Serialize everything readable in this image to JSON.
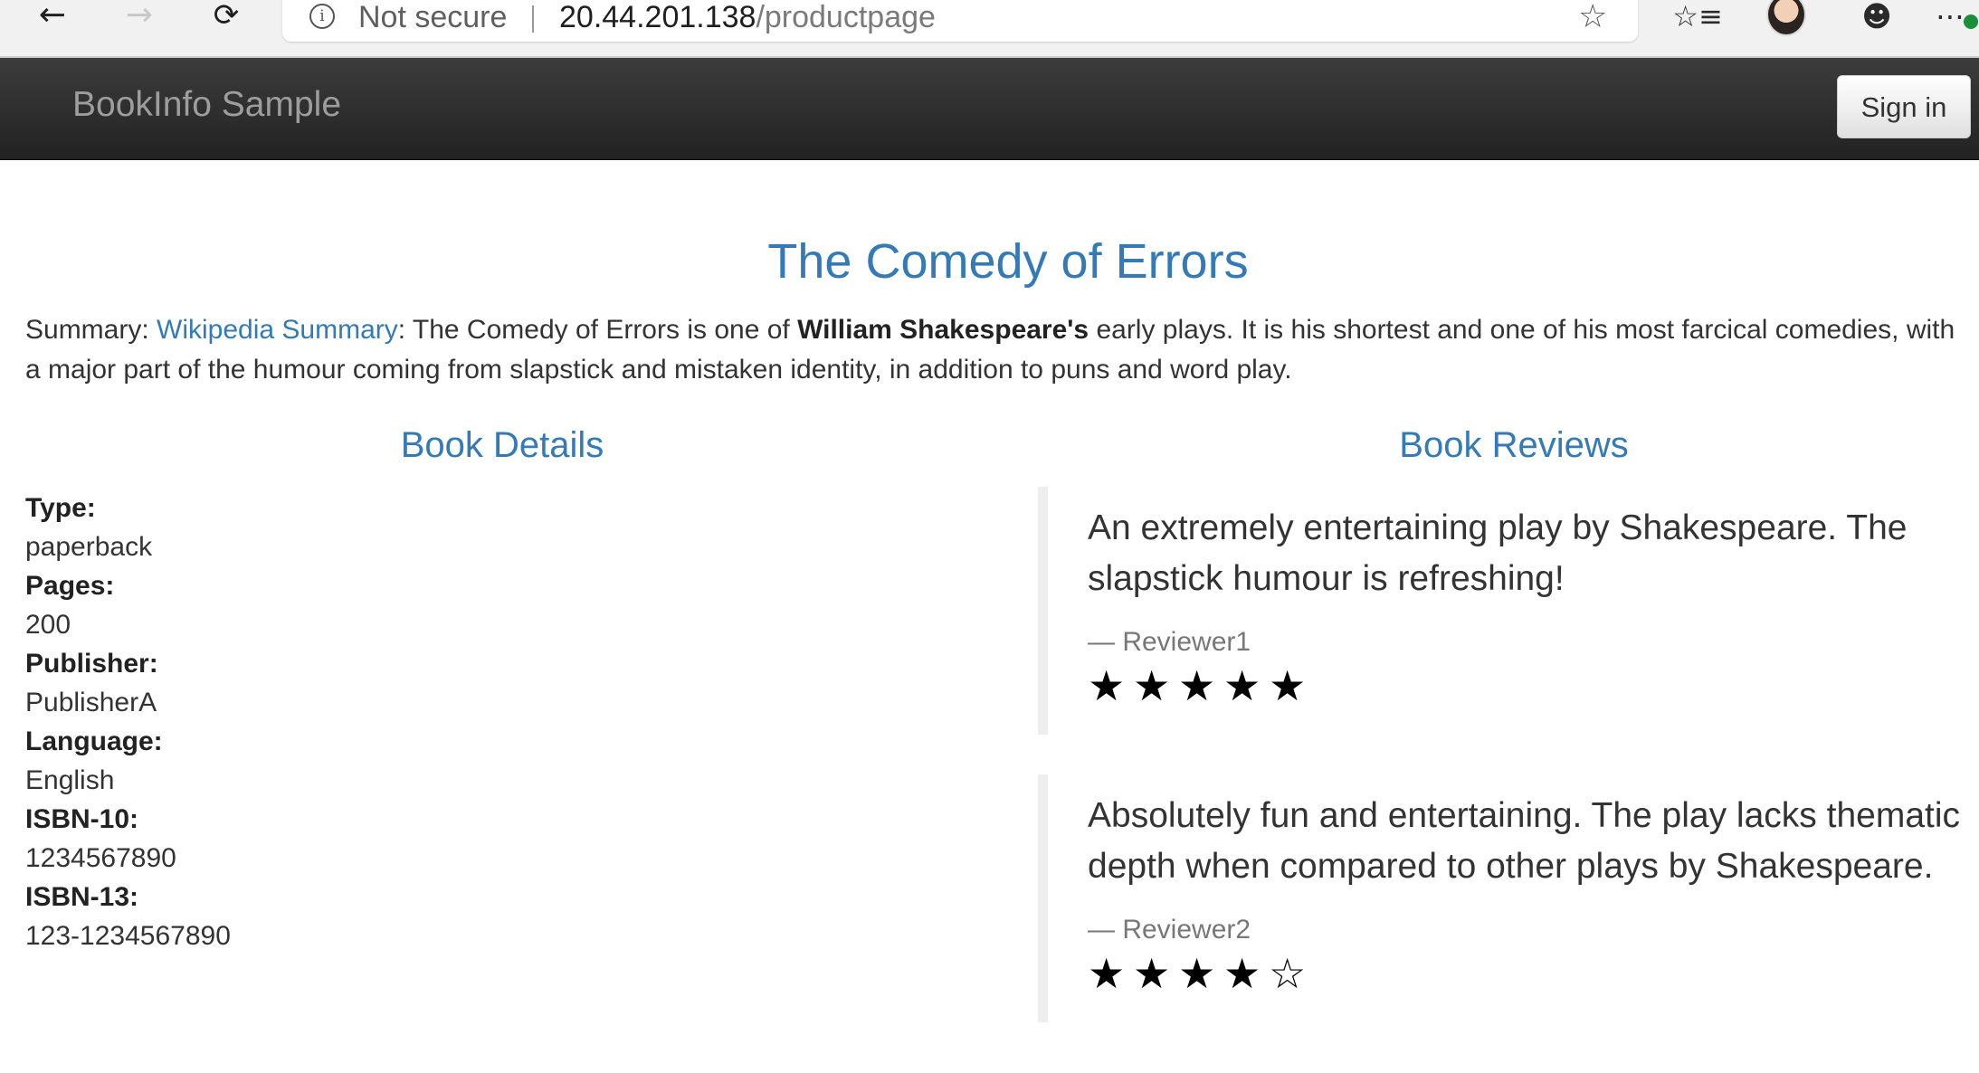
{
  "browser": {
    "back_icon": "arrow-left-icon",
    "forward_icon": "arrow-right-icon",
    "refresh_icon": "refresh-icon",
    "security_label": "Not secure",
    "url_host": "20.44.201.138",
    "url_path": "/productpage",
    "toolbar_icons": [
      "favorite-star-icon",
      "favorites-list-icon",
      "profile-avatar",
      "share-people-icon",
      "more-icon"
    ]
  },
  "navbar": {
    "brand": "BookInfo Sample",
    "signin_label": "Sign in"
  },
  "product": {
    "title": "The Comedy of Errors",
    "summary_prefix": "Summary: ",
    "summary_link": "Wikipedia Summary",
    "summary_mid": ": The Comedy of Errors is one of ",
    "summary_bold": "William Shakespeare's",
    "summary_rest": " early plays. It is his shortest and one of his most farcical comedies, with a major part of the humour coming from slapstick and mistaken identity, in addition to puns and word play."
  },
  "details": {
    "heading": "Book Details",
    "fields": [
      {
        "label": "Type:",
        "value": "paperback"
      },
      {
        "label": "Pages:",
        "value": "200"
      },
      {
        "label": "Publisher:",
        "value": "PublisherA"
      },
      {
        "label": "Language:",
        "value": "English"
      },
      {
        "label": "ISBN-10:",
        "value": "1234567890"
      },
      {
        "label": "ISBN-13:",
        "value": "123-1234567890"
      }
    ]
  },
  "reviews": {
    "heading": "Book Reviews",
    "items": [
      {
        "text": "An extremely entertaining play by Shakespeare. The slapstick humour is refreshing!",
        "author": "— Reviewer1",
        "rating": 5,
        "max_rating": 5,
        "star_color": "#000000"
      },
      {
        "text": "Absolutely fun and entertaining. The play lacks thematic depth when compared to other plays by Shakespeare.",
        "author": "— Reviewer2",
        "rating": 4,
        "max_rating": 5,
        "star_color": "#000000"
      }
    ]
  },
  "colors": {
    "link": "#337ab7",
    "navbar": "#222222",
    "brand_text": "#9d9d9d"
  }
}
